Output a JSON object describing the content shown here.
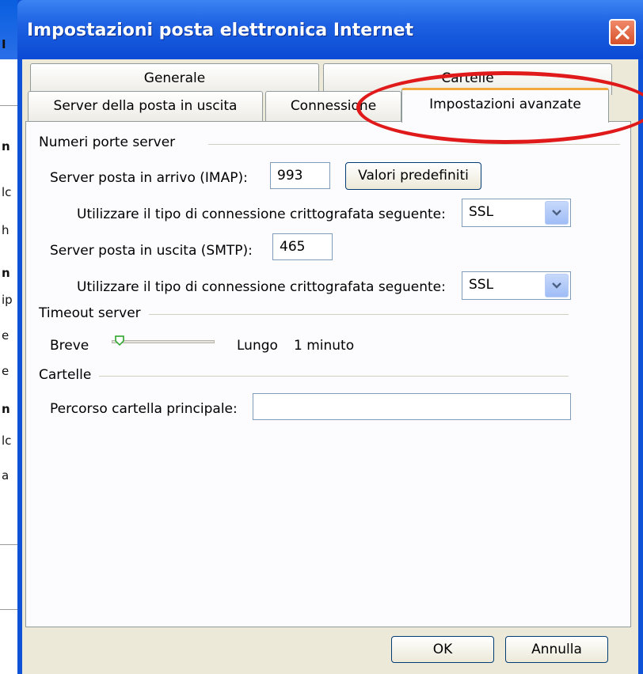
{
  "window": {
    "title": "Impostazioni posta elettronica Internet"
  },
  "background": {
    "chars": [
      "I",
      "n",
      "lc",
      "h",
      "n",
      "ip",
      "e",
      "e",
      "n",
      "lc",
      "a"
    ]
  },
  "tabs": {
    "row_back": [
      {
        "label": "Generale"
      },
      {
        "label": "Cartelle"
      }
    ],
    "row_front": [
      {
        "label": "Server della posta in uscita"
      },
      {
        "label": "Connessione"
      },
      {
        "label": "Impostazioni avanzate",
        "active": true
      }
    ]
  },
  "ports_group": {
    "title": "Numeri porte server",
    "incoming_label": "Server posta in arrivo (IMAP):",
    "incoming_value": "993",
    "defaults_button": "Valori predefiniti",
    "incoming_encryption_label": "Utilizzare il tipo di connessione crittografata seguente:",
    "incoming_encryption_value": "SSL",
    "outgoing_label": "Server posta in uscita (SMTP):",
    "outgoing_value": "465",
    "outgoing_encryption_label": "Utilizzare il tipo di connessione crittografata seguente:",
    "outgoing_encryption_value": "SSL"
  },
  "timeout_group": {
    "title": "Timeout server",
    "short_label": "Breve",
    "long_label": "Lungo",
    "value_text": "1 minuto",
    "slider_level": 0.05
  },
  "folders_group": {
    "title": "Cartelle",
    "root_label": "Percorso cartella principale:",
    "root_value": ""
  },
  "buttons": {
    "ok": "OK",
    "cancel": "Annulla"
  },
  "colors": {
    "title_bar": "#0a49d4",
    "dialog_bg": "#ece9d8",
    "active_tab_accent": "#f2a83a",
    "annotation": "#e01a1a"
  }
}
